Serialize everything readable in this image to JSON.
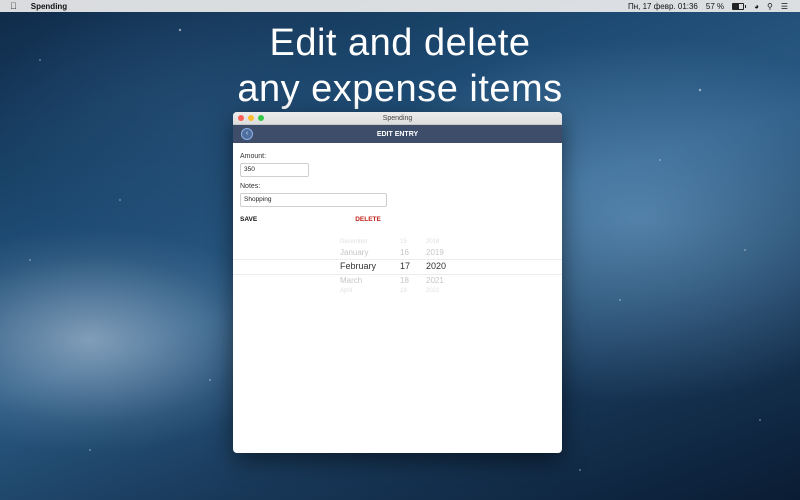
{
  "menubar": {
    "apple_icon": "apple-logo",
    "app_name": "Spending",
    "datetime": "Пн, 17 февр.  01:36",
    "battery": "57 %",
    "battery_level_percent": 57,
    "icons": [
      "wifi-icon",
      "battery-icon",
      "search-icon",
      "menu-list-icon"
    ]
  },
  "headline": {
    "line1": "Edit and delete",
    "line2": "any expense items"
  },
  "window": {
    "title": "Spending",
    "nav_title": "EDIT ENTRY",
    "back_icon": "chevron-left-icon",
    "form": {
      "amount_label": "Amount:",
      "amount_value": "350",
      "notes_label": "Notes:",
      "notes_value": "Shopping",
      "save_label": "SAVE",
      "delete_label": "DELETE"
    },
    "date_picker": {
      "months": [
        "December",
        "January",
        "February",
        "March",
        "April"
      ],
      "days": [
        "15",
        "16",
        "17",
        "18",
        "19"
      ],
      "years": [
        "2018",
        "2019",
        "2020",
        "2021",
        "2022"
      ],
      "selected": {
        "month": "February",
        "day": "17",
        "year": "2020"
      }
    }
  }
}
